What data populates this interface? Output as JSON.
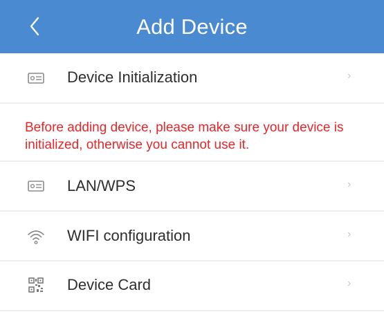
{
  "header": {
    "title": "Add Device",
    "back_icon": "chevron-left-icon"
  },
  "rows": [
    {
      "label": "Device Initialization",
      "icon": "device-card-icon",
      "chevron": "›"
    },
    {
      "label": "LAN/WPS",
      "icon": "device-card-icon",
      "chevron": "›"
    },
    {
      "label": "WIFI configuration",
      "icon": "wifi-icon",
      "chevron": "›"
    },
    {
      "label": "Device Card",
      "icon": "qr-code-icon",
      "chevron": "›"
    }
  ],
  "notice": {
    "text": "Before adding device, please make sure your device is initialized, otherwise you cannot use it."
  },
  "colors": {
    "header_bg": "#4a8ad1",
    "notice_text": "#e5262a",
    "label_text": "#2e2e2e",
    "icon_gray": "#8a8a8a"
  }
}
